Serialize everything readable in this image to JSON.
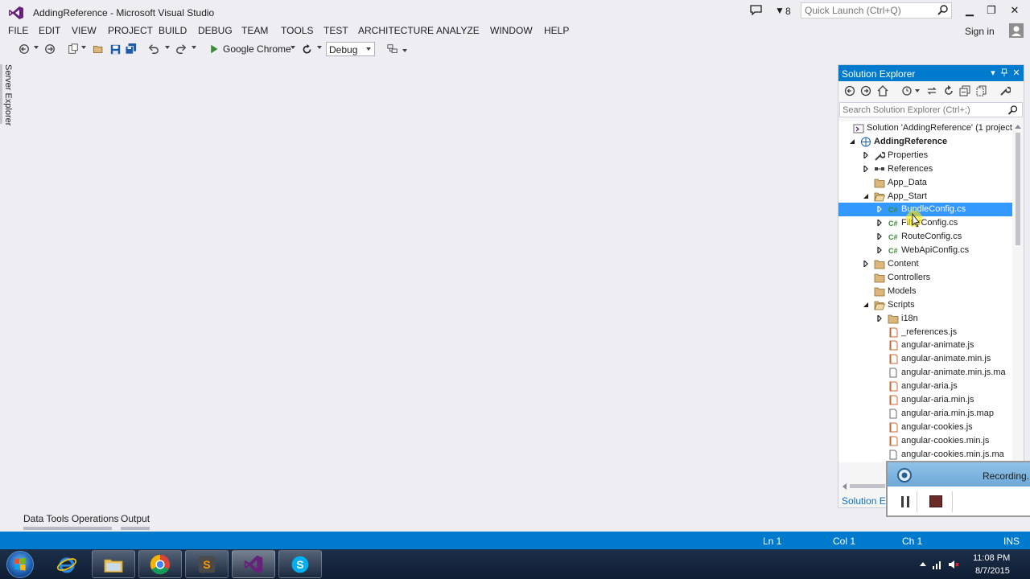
{
  "window": {
    "title": "AddingReference - Microsoft Visual Studio",
    "notification_count": "8",
    "quick_launch_placeholder": "Quick Launch (Ctrl+Q)",
    "sign_in": "Sign in"
  },
  "menu": [
    "FILE",
    "EDIT",
    "VIEW",
    "PROJECT",
    "BUILD",
    "DEBUG",
    "TEAM",
    "TOOLS",
    "TEST",
    "ARCHITECTURE",
    "ANALYZE",
    "WINDOW",
    "HELP"
  ],
  "toolbar": {
    "start_target": "Google Chrome",
    "configuration": "Debug"
  },
  "left_panel": {
    "server_explorer": "Server Explorer"
  },
  "bottom_tabs": [
    "Data Tools Operations",
    "Output"
  ],
  "solution_explorer": {
    "title": "Solution Explorer",
    "search_placeholder": "Search Solution Explorer (Ctrl+;)",
    "footer_tab": "Solution Ex",
    "items": [
      {
        "label": "Solution 'AddingReference' (1 project",
        "icon": "solution-icon",
        "arrow": "none",
        "bold": false
      },
      {
        "label": "AddingReference",
        "icon": "web-project-icon",
        "arrow": "expanded",
        "bold": true
      },
      {
        "label": "Properties",
        "icon": "wrench-icon",
        "arrow": "collapsed",
        "bold": false
      },
      {
        "label": "References",
        "icon": "references-icon",
        "arrow": "collapsed",
        "bold": false
      },
      {
        "label": "App_Data",
        "icon": "folder-icon",
        "arrow": "none",
        "bold": false
      },
      {
        "label": "App_Start",
        "icon": "folder-open-icon",
        "arrow": "expanded",
        "bold": false
      },
      {
        "label": "BundleConfig.cs",
        "icon": "csharp-file-icon",
        "arrow": "collapsed",
        "bold": false,
        "selected": true
      },
      {
        "label": "FilterConfig.cs",
        "icon": "csharp-file-icon",
        "arrow": "collapsed",
        "bold": false
      },
      {
        "label": "RouteConfig.cs",
        "icon": "csharp-file-icon",
        "arrow": "collapsed",
        "bold": false
      },
      {
        "label": "WebApiConfig.cs",
        "icon": "csharp-file-icon",
        "arrow": "collapsed",
        "bold": false
      },
      {
        "label": "Content",
        "icon": "folder-icon",
        "arrow": "collapsed",
        "bold": false
      },
      {
        "label": "Controllers",
        "icon": "folder-icon",
        "arrow": "none",
        "bold": false
      },
      {
        "label": "Models",
        "icon": "folder-icon",
        "arrow": "none",
        "bold": false
      },
      {
        "label": "Scripts",
        "icon": "folder-open-icon",
        "arrow": "expanded",
        "bold": false
      },
      {
        "label": "i18n",
        "icon": "folder-icon",
        "arrow": "collapsed",
        "bold": false
      },
      {
        "label": "_references.js",
        "icon": "js-file-icon",
        "arrow": "none",
        "bold": false
      },
      {
        "label": "angular-animate.js",
        "icon": "js-file-icon",
        "arrow": "none",
        "bold": false
      },
      {
        "label": "angular-animate.min.js",
        "icon": "js-file-icon",
        "arrow": "none",
        "bold": false
      },
      {
        "label": "angular-animate.min.js.ma",
        "icon": "map-file-icon",
        "arrow": "none",
        "bold": false
      },
      {
        "label": "angular-aria.js",
        "icon": "js-file-icon",
        "arrow": "none",
        "bold": false
      },
      {
        "label": "angular-aria.min.js",
        "icon": "js-file-icon",
        "arrow": "none",
        "bold": false
      },
      {
        "label": "angular-aria.min.js.map",
        "icon": "map-file-icon",
        "arrow": "none",
        "bold": false
      },
      {
        "label": "angular-cookies.js",
        "icon": "js-file-icon",
        "arrow": "none",
        "bold": false
      },
      {
        "label": "angular-cookies.min.js",
        "icon": "js-file-icon",
        "arrow": "none",
        "bold": false
      },
      {
        "label": "angular-cookies.min.js.ma",
        "icon": "map-file-icon",
        "arrow": "none",
        "bold": false
      }
    ]
  },
  "recording": {
    "label": "Recording..."
  },
  "statusbar": {
    "ln": "Ln 1",
    "col": "Col 1",
    "ch": "Ch 1",
    "mode": "INS"
  },
  "taskbar": {
    "time": "11:08 PM",
    "date": "8/7/2015",
    "apps": [
      "internet-explorer-icon",
      "file-explorer-icon",
      "chrome-icon",
      "sublime-text-icon",
      "visual-studio-icon",
      "skype-icon"
    ]
  },
  "colors": {
    "accent": "#007acc",
    "selection": "#3399ff",
    "background": "#eeeef2"
  }
}
